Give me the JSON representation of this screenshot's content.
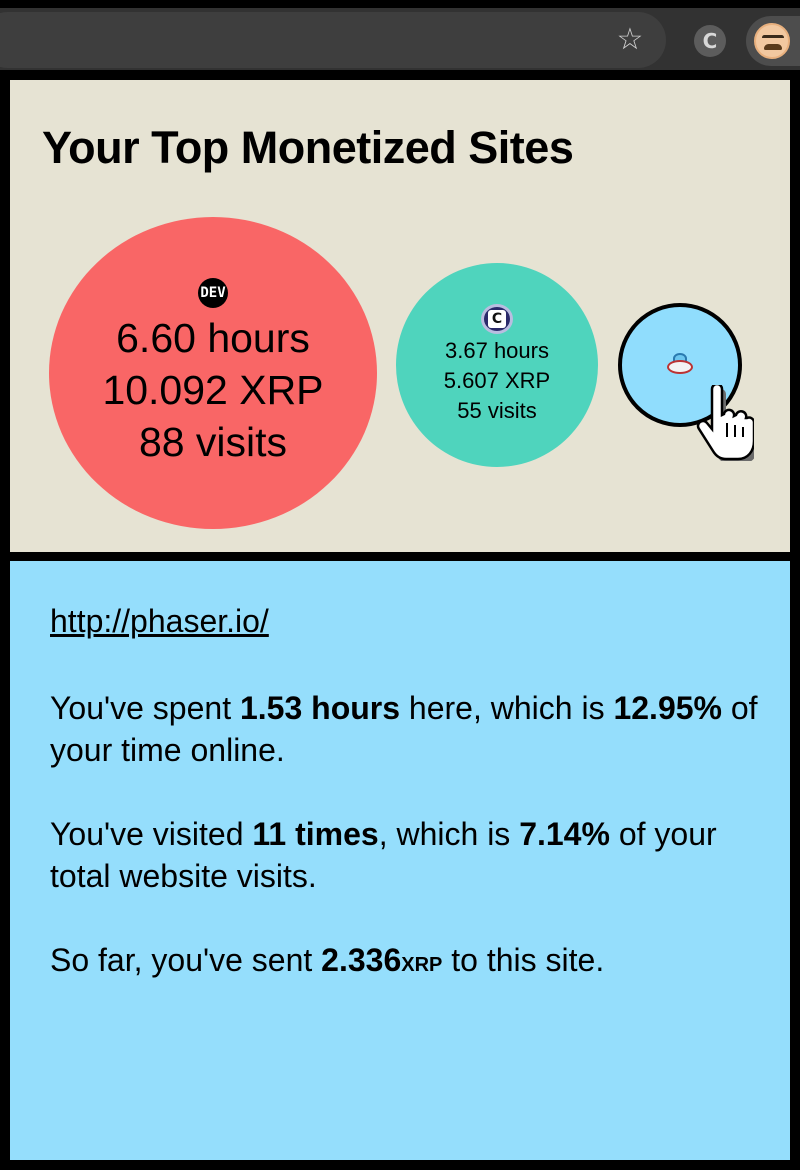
{
  "browser": {
    "star_icon": "star-icon",
    "extension_c_label": "C",
    "extension_avatar_icon": "coil-avatar-icon"
  },
  "page": {
    "title": "Your Top Monetized Sites"
  },
  "sites": [
    {
      "favicon_text": "DEV",
      "hours": "6.60 hours",
      "xrp": "10.092 XRP",
      "visits": "88 visits",
      "color": "#f96666"
    },
    {
      "favicon_text": "C",
      "hours": "3.67 hours",
      "xrp": "5.607 XRP",
      "visits": "55 visits",
      "color": "#4fd4bd"
    },
    {
      "favicon_icon": "phaser-ufo-icon",
      "color": "#90ddfd",
      "selected": true
    }
  ],
  "detail": {
    "url": "http://phaser.io/",
    "time_prefix": "You've spent ",
    "time_value": "1.53 hours",
    "time_middle": " here, which is ",
    "time_percent": "12.95%",
    "time_suffix": " of your time online.",
    "visits_prefix": "You've visited ",
    "visits_value": "11 times",
    "visits_middle": ", which is ",
    "visits_percent": "7.14%",
    "visits_suffix": " of your total website visits.",
    "sent_prefix": "So far, you've sent ",
    "sent_value": "2.336",
    "sent_unit": "XRP",
    "sent_suffix": " to this site."
  },
  "colors": {
    "top_panel_bg": "#e6e3d3",
    "bottom_panel_bg": "#95defc"
  }
}
